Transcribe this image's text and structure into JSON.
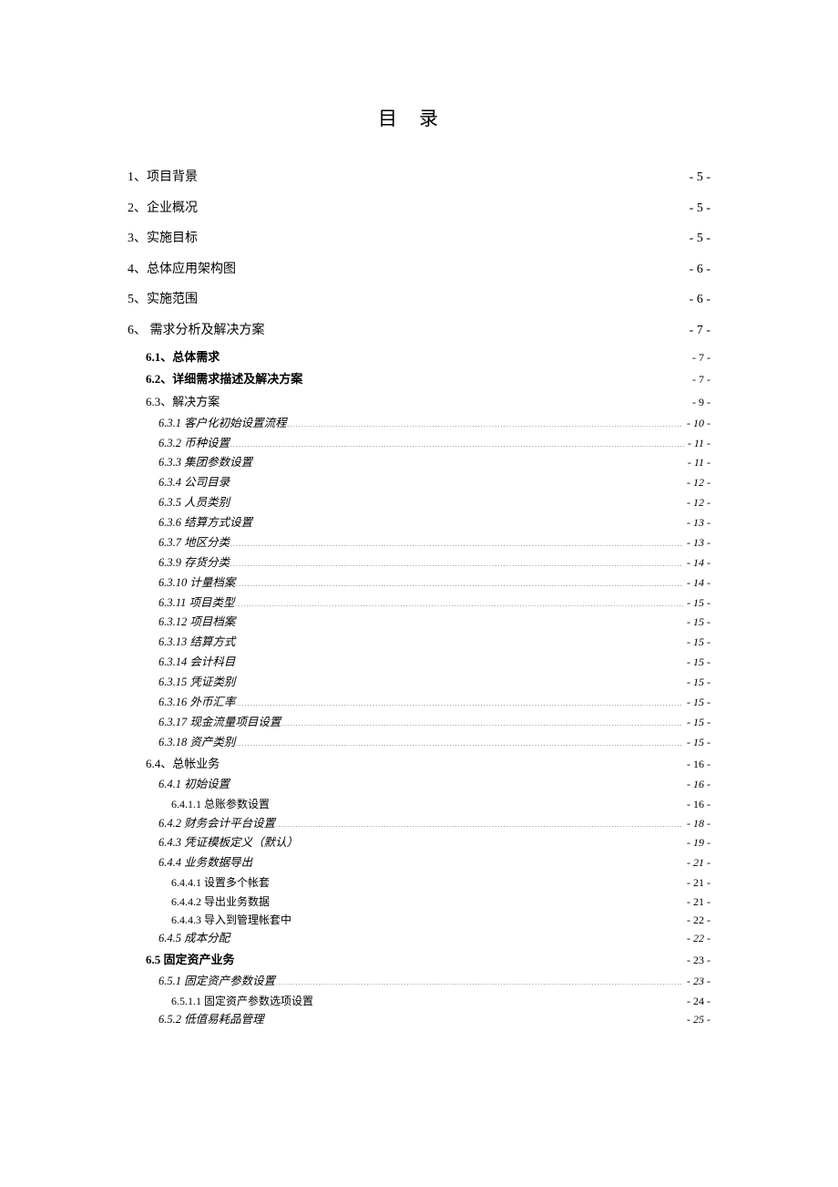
{
  "title": "目录",
  "toc": [
    {
      "level": 1,
      "num": "1、",
      "label": "项目背景",
      "page": "- 5 -"
    },
    {
      "level": 1,
      "num": "2、",
      "label": "企业概况",
      "page": "- 5 -"
    },
    {
      "level": 1,
      "num": "3、",
      "label": "实施目标",
      "page": "- 5 -"
    },
    {
      "level": 1,
      "num": "4、",
      "label": "总体应用架构图",
      "page": "- 6 -"
    },
    {
      "level": 1,
      "num": "5、",
      "label": "实施范围",
      "page": "- 6 -"
    },
    {
      "level": 1,
      "num": "6、",
      "label": " 需求分析及解决方案",
      "page": "- 7 -"
    },
    {
      "level": 2,
      "num": "6.1、",
      "label": "总体需求",
      "page": "- 7 -",
      "bold": true
    },
    {
      "level": 2,
      "num": "6.2、",
      "label": "详细需求描述及解决方案",
      "page": "- 7 -",
      "bold": true
    },
    {
      "level": 2,
      "num": "6.3、",
      "label": "解决方案",
      "page": "- 9 -",
      "bold": false
    },
    {
      "level": 3,
      "num": "6.3.1",
      "label": " 客户化初始设置流程",
      "page": "- 10 -"
    },
    {
      "level": 3,
      "num": "6.3.2",
      "label": " 币种设置",
      "page": "- 11 -"
    },
    {
      "level": 3,
      "num": "6.3.3",
      "label": " 集团参数设置",
      "page": "- 11 -"
    },
    {
      "level": 3,
      "num": "6.3.4",
      "label": "  公司目录",
      "page": "- 12 -"
    },
    {
      "level": 3,
      "num": "6.3.5",
      "label": "  人员类别",
      "page": "- 12 -"
    },
    {
      "level": 3,
      "num": "6.3.6",
      "label": " 结算方式设置",
      "page": "- 13 -"
    },
    {
      "level": 3,
      "num": "6.3.7",
      "label": " 地区分类",
      "page": "- 13 -"
    },
    {
      "level": 3,
      "num": "6.3.9",
      "label": " 存货分类",
      "page": "- 14 -"
    },
    {
      "level": 3,
      "num": "6.3.10",
      "label": " 计量档案",
      "page": "- 14 -"
    },
    {
      "level": 3,
      "num": "6.3.11",
      "label": " 项目类型",
      "page": "- 15 -"
    },
    {
      "level": 3,
      "num": "6.3.12",
      "label": " 项目档案",
      "page": "- 15 -"
    },
    {
      "level": 3,
      "num": "6.3.13",
      "label": "  结算方式",
      "page": "- 15 -"
    },
    {
      "level": 3,
      "num": "6.3.14",
      "label": "  会计科目",
      "page": "- 15 -"
    },
    {
      "level": 3,
      "num": "6.3.15",
      "label": "  凭证类别",
      "page": "- 15 -"
    },
    {
      "level": 3,
      "num": "6.3.16",
      "label": "  外币汇率",
      "page": "- 15 -"
    },
    {
      "level": 3,
      "num": "6.3.17",
      "label": " 现金流量项目设置",
      "page": "- 15 -"
    },
    {
      "level": 3,
      "num": "6.3.18",
      "label": " 资产类别",
      "page": "- 15 -"
    },
    {
      "level": 2,
      "num": "6.4、",
      "label": "总帐业务",
      "page": "- 16 -",
      "bold": false
    },
    {
      "level": 3,
      "num": "6.4.1",
      "label": " 初始设置",
      "page": "- 16 -"
    },
    {
      "level": 4,
      "num": "6.4.1.1",
      "label": " 总账参数设置",
      "page": "- 16 -"
    },
    {
      "level": 3,
      "num": "6.4.2",
      "label": " 财务会计平台设置",
      "page": "- 18 -"
    },
    {
      "level": 3,
      "num": "6.4.3",
      "label": " 凭证模板定义（默认）",
      "page": "- 19 -"
    },
    {
      "level": 3,
      "num": "6.4.4",
      "label": " 业务数据导出",
      "page": "- 21 -"
    },
    {
      "level": 4,
      "num": "6.4.4.1",
      "label": " 设置多个帐套",
      "page": "- 21 -"
    },
    {
      "level": 4,
      "num": "6.4.4.2",
      "label": " 导出业务数据",
      "page": "- 21 -"
    },
    {
      "level": 4,
      "num": "6.4.4.3",
      "label": " 导入到管理帐套中",
      "page": "- 22 -"
    },
    {
      "level": 3,
      "num": "6.4.5",
      "label": " 成本分配",
      "page": "- 22 -"
    },
    {
      "level": 2,
      "num": "6.5",
      "label": " 固定资产业务",
      "page": "- 23 -",
      "bold": true
    },
    {
      "level": 3,
      "num": "6.5.1",
      "label": " 固定资产参数设置",
      "page": "- 23 -"
    },
    {
      "level": 4,
      "num": "6.5.1.1",
      "label": " 固定资产参数选项设置",
      "page": "- 24 -"
    },
    {
      "level": 3,
      "num": "6.5.2",
      "label": " 低值易耗品管理",
      "page": "- 25 -"
    }
  ]
}
